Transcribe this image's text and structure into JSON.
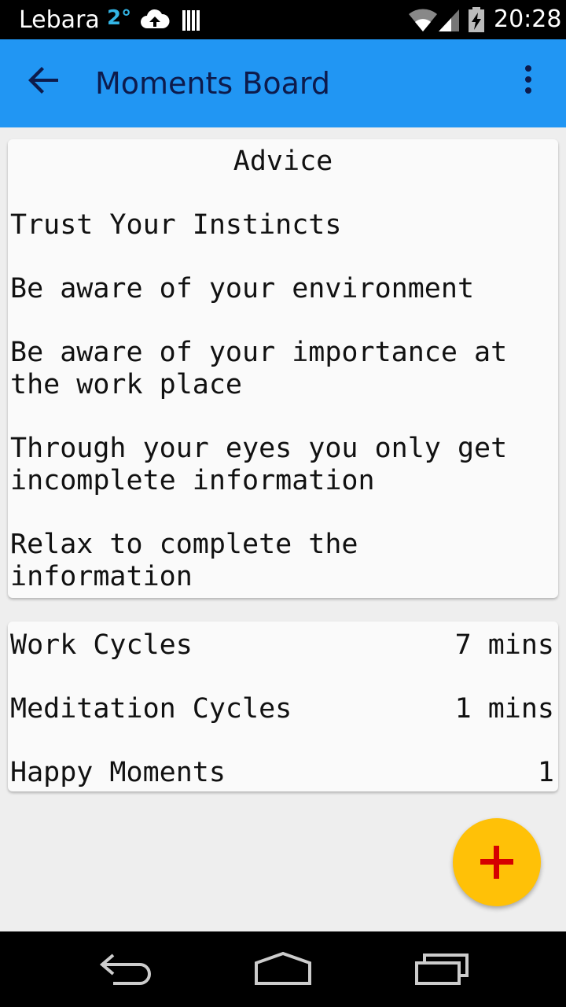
{
  "status_bar": {
    "carrier": "Lebara",
    "temperature": "2°",
    "time": "20:28",
    "icons": [
      "cloud-upload-icon",
      "storage-bars-icon",
      "wifi-icon",
      "signal-icon",
      "battery-charging-icon"
    ]
  },
  "app_bar": {
    "title": "Moments Board",
    "back_icon": "arrow-back-icon",
    "menu_icon": "more-vert-icon",
    "color": "#2196f3"
  },
  "advice": {
    "title": "Advice",
    "items": [
      "Trust Your Instincts",
      "Be aware of your environment",
      "Be aware of your importance at the work place",
      "Through your eyes you only get incomplete information",
      "Relax to complete the information"
    ]
  },
  "stats": [
    {
      "label": "Work Cycles",
      "value": "7 mins"
    },
    {
      "label": "Meditation Cycles",
      "value": "1 mins"
    },
    {
      "label": "Happy Moments",
      "value": "1"
    }
  ],
  "fab": {
    "icon": "plus-icon",
    "color": "#ffc107",
    "icon_color": "#d50000"
  },
  "nav_bar": {
    "icons": [
      "back-nav-icon",
      "home-nav-icon",
      "recents-nav-icon"
    ]
  }
}
